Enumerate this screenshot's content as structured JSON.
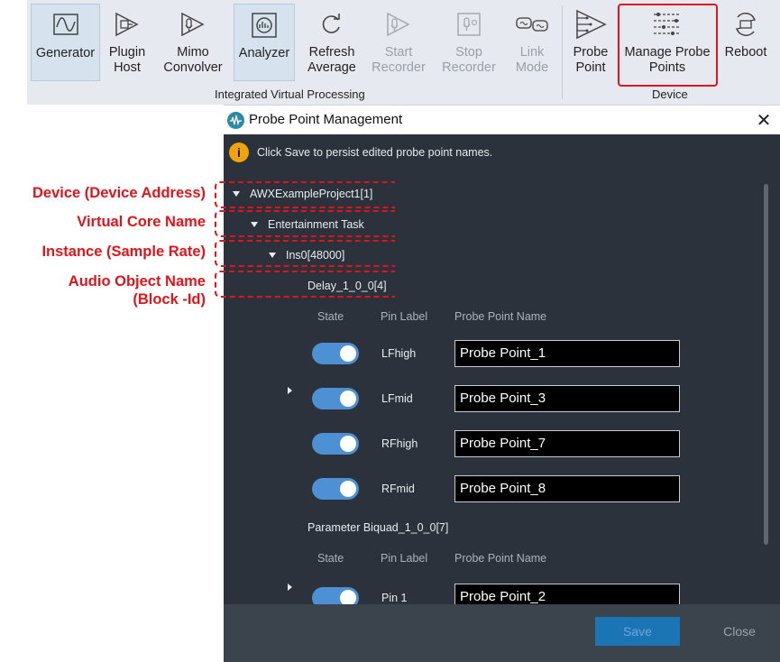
{
  "ribbon": {
    "groups": {
      "integrated": "Integrated Virtual Processing",
      "device": "Device"
    },
    "buttons": {
      "generator": "Generator",
      "plugin_host": "Plugin Host",
      "mimo_convolver": "Mimo Convolver",
      "analyzer": "Analyzer",
      "refresh_average": "Refresh Average",
      "start_recorder": "Start Recorder",
      "stop_recorder": "Stop Recorder",
      "link_mode": "Link Mode",
      "probe_point": "Probe Point",
      "manage_probe_points": "Manage Probe Points",
      "reboot": "Reboot"
    }
  },
  "dialog": {
    "title": "Probe Point Management",
    "close_glyph": "✕",
    "info_icon": "i",
    "info_text": "Click Save to persist edited probe point names.",
    "tree": {
      "device": "AWXExampleProject1[1]",
      "core": "Entertainment Task",
      "instance": "Ins0[48000]",
      "audio_object": "Delay_1_0_0[4]"
    },
    "columns": {
      "state": "State",
      "pin_label": "Pin Label",
      "probe_name": "Probe Point Name"
    },
    "pins": [
      {
        "label": "LFhigh",
        "name": "Probe Point_1",
        "state": "on"
      },
      {
        "label": "LFmid",
        "name": "Probe Point_3",
        "state": "on"
      },
      {
        "label": "RFhigh",
        "name": "Probe Point_7",
        "state": "on"
      },
      {
        "label": "RFmid",
        "name": "Probe Point_8",
        "state": "on"
      }
    ],
    "section2": {
      "title": "Parameter Biquad_1_0_0[7]",
      "columns": {
        "state": "State",
        "pin_label": "Pin Label",
        "probe_name": "Probe Point Name"
      },
      "pins": [
        {
          "label": "Pin 1",
          "name": "Probe Point_2",
          "state": "on"
        }
      ]
    },
    "footer": {
      "save": "Save",
      "close": "Close"
    }
  },
  "annotations": {
    "device": "Device (Device Address)",
    "core": "Virtual Core Name",
    "instance": "Instance (Sample Rate)",
    "audio_object_line1": "Audio Object Name",
    "audio_object_line2": "(Block -Id)"
  },
  "colors": {
    "annotation": "#e0141a",
    "dialog_bg": "#2b323b",
    "toggle_on": "#4d91d4",
    "accent": "#1b74b4",
    "ribbon_bg": "#e6eaf0"
  }
}
